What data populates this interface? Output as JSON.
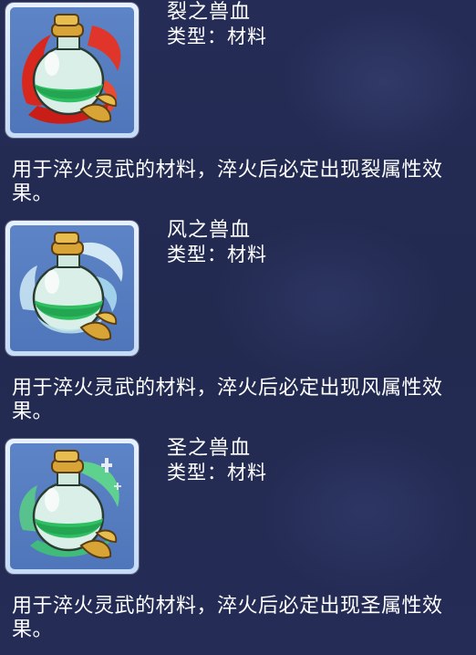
{
  "items": [
    {
      "name": "裂之兽血",
      "type_label": "类型：",
      "type_value": "材料",
      "description": "用于淬火灵武的材料，淬火后必定出现裂属性效果。",
      "icon": "red-blood-potion-icon",
      "accent": "#d8281e"
    },
    {
      "name": "风之兽血",
      "type_label": "类型：",
      "type_value": "材料",
      "description": "用于淬火灵武的材料，淬火后必定出现风属性效果。",
      "icon": "wind-blood-potion-icon",
      "accent": "#bfe6f3"
    },
    {
      "name": "圣之兽血",
      "type_label": "类型：",
      "type_value": "材料",
      "description": "用于淬火灵武的材料，淬火后必定出现圣属性效果。",
      "icon": "holy-blood-potion-icon",
      "accent": "#45d27a"
    }
  ]
}
